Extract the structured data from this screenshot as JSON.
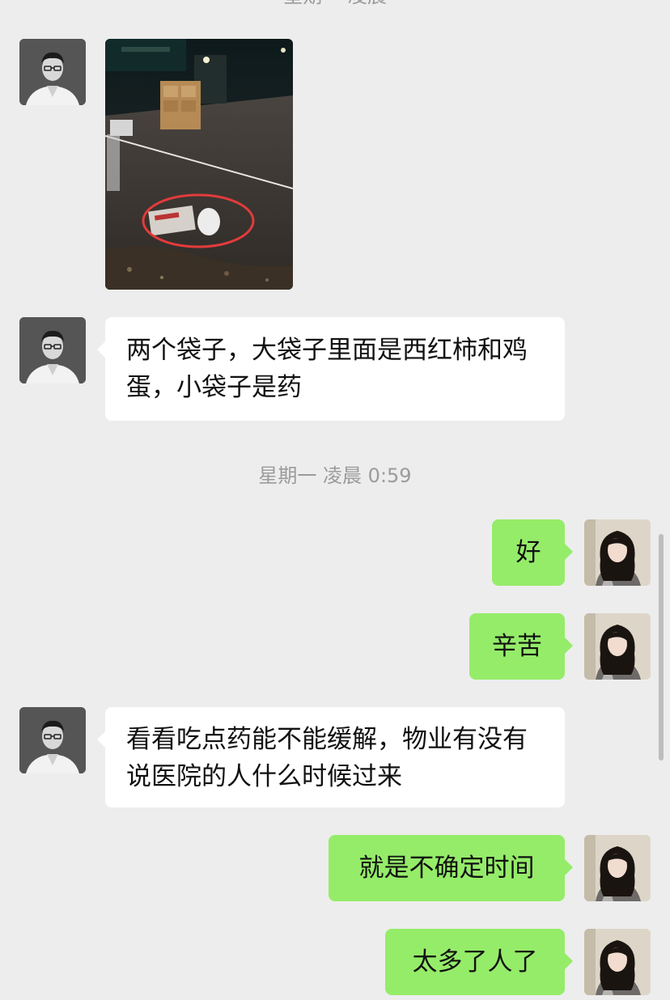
{
  "chat": {
    "top_timestamp_partial": "星期一 凌晨",
    "timestamp": "星期一 凌晨 0:59",
    "messages": [
      {
        "side": "left",
        "type": "image"
      },
      {
        "side": "left",
        "type": "text",
        "text": "两个袋子，大袋子里面是西红柿和鸡蛋，小袋子是药"
      },
      {
        "side": "right",
        "type": "text",
        "text": "好"
      },
      {
        "side": "right",
        "type": "text",
        "text": "辛苦"
      },
      {
        "side": "left",
        "type": "text",
        "text": "看看吃点药能不能缓解，物业有没有说医院的人什么时候过来"
      },
      {
        "side": "right",
        "type": "text",
        "text": "就是不确定时间"
      },
      {
        "side": "right",
        "type": "text",
        "text": "太多了人了"
      }
    ]
  },
  "colors": {
    "background": "#ededed",
    "incoming_bubble": "#ffffff",
    "outgoing_bubble": "#95ec69",
    "timestamp_text": "#9b9b9b"
  }
}
